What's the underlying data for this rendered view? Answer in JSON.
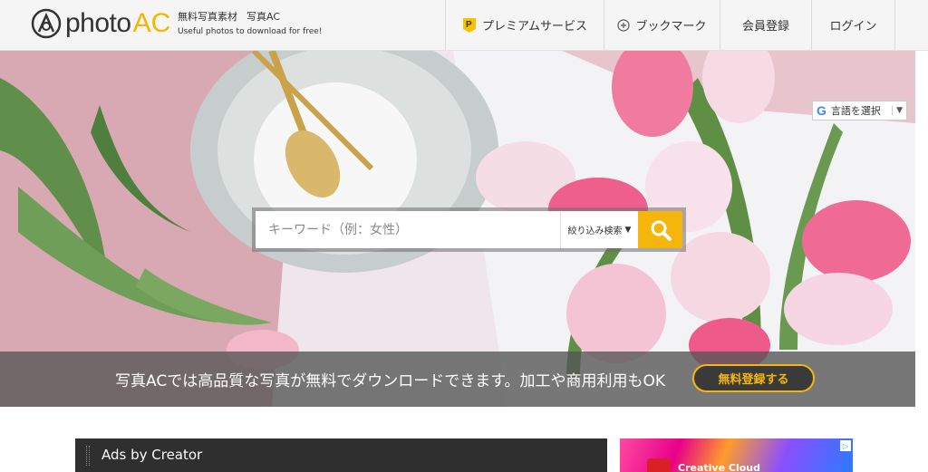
{
  "header": {
    "logo_photo": "photo",
    "logo_ac": "AC",
    "tagline_jp_1": "無料写真素材",
    "tagline_jp_2": "写真AC",
    "tagline_en": "Useful photos to download for free!"
  },
  "nav": {
    "premium": "プレミアムサービス",
    "bookmark": "ブックマーク",
    "register": "会員登録",
    "login": "ログイン"
  },
  "language": {
    "logo": "G",
    "label": "言語を選択",
    "arrow": "▼"
  },
  "search": {
    "placeholder": "キーワード（例：女性）",
    "filter_label": "絞り込み検索",
    "filter_arrow": "▼"
  },
  "banner": {
    "message": "写真ACでは高品質な写真が無料でダウンロードできます。加工や商用利用もOK",
    "cta": "無料登録する"
  },
  "ads": {
    "title": "Ads by Creator",
    "right_label": "Creative Cloud"
  },
  "colors": {
    "accent": "#f5b60b",
    "band": "#555555"
  },
  "icons": {
    "premium": "premium-badge-icon",
    "bookmark": "plus-circle-icon",
    "search": "search-icon"
  }
}
